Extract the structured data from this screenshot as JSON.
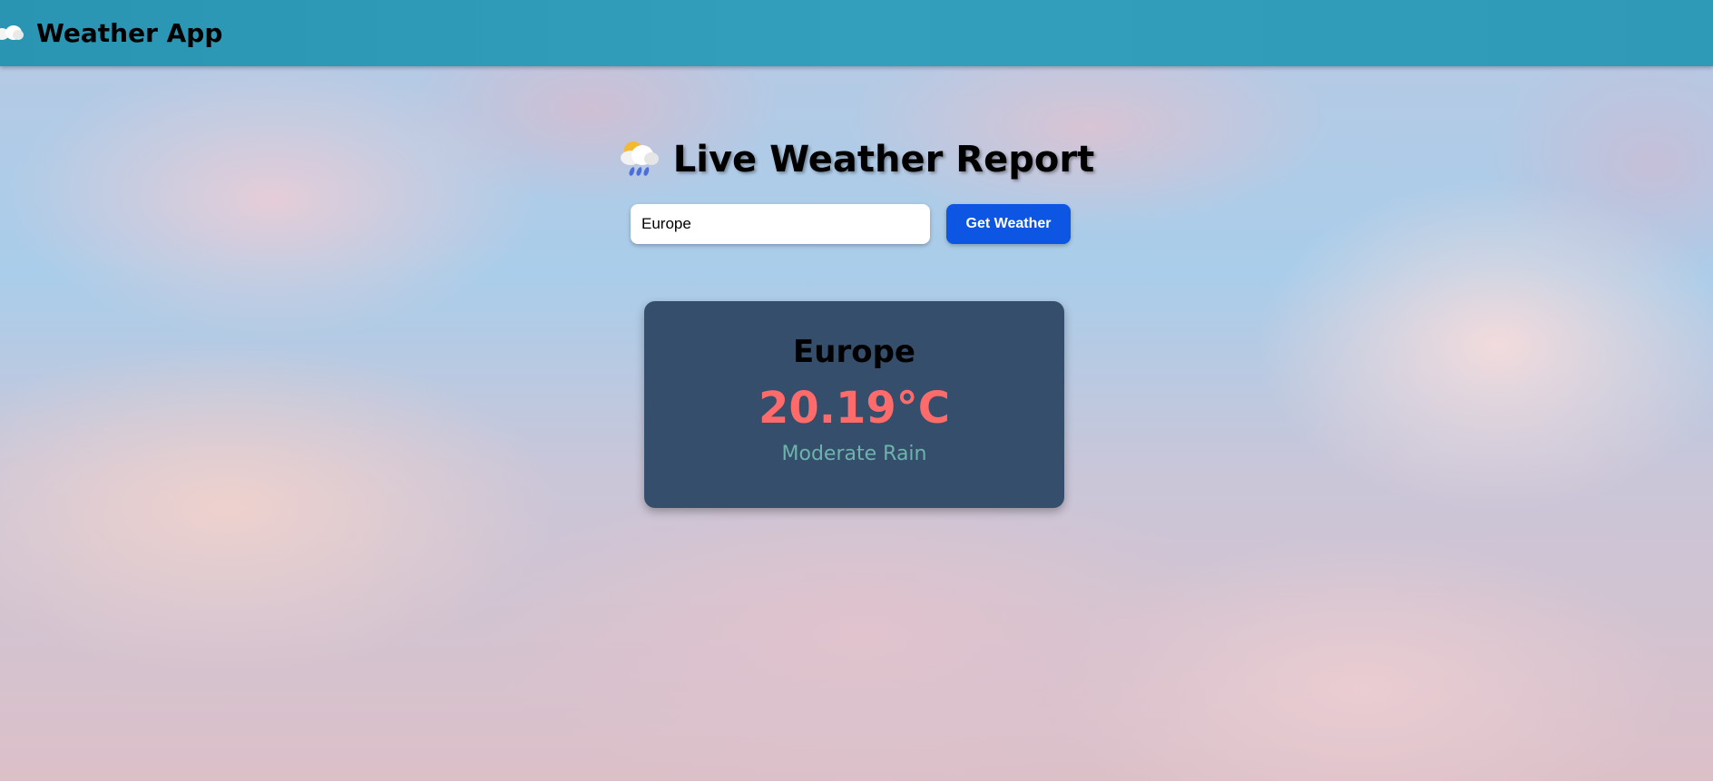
{
  "navbar": {
    "icon": "cloud-icon",
    "title": "Weather App"
  },
  "heading": {
    "icon": "sun-behind-rain-cloud-icon",
    "text": "Live Weather Report"
  },
  "search": {
    "value": "Europe",
    "button_label": "Get Weather"
  },
  "result": {
    "city": "Europe",
    "temperature": "20.19°C",
    "description": "Moderate Rain"
  },
  "colors": {
    "navbar": "#2f9ab8",
    "button": "#0d55e3",
    "card": "#344e6b",
    "temperature": "#ff6b6b",
    "description": "#6fb3ad"
  }
}
